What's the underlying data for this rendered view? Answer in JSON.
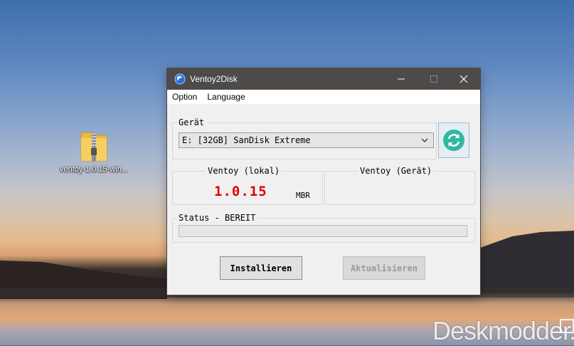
{
  "desktop": {
    "icon_label": "ventoy-1.0.15-win...",
    "watermark": "Deskmodder.de"
  },
  "window": {
    "title": "Ventoy2Disk",
    "menu": [
      "Option",
      "Language"
    ],
    "device_group_label": "Gerät",
    "device_selected": "E: [32GB] SanDisk Extreme",
    "local_group_label": "Ventoy (lokal)",
    "local_version": "1.0.15",
    "partition_style": "MBR",
    "device_version_label": "Ventoy (Gerät)",
    "device_version": "",
    "status_label": "Status - BEREIT",
    "progress": 0,
    "install_button": "Installieren",
    "update_button": "Aktualisieren"
  },
  "colors": {
    "version_text": "#e00000",
    "refresh_icon": "#2eb8a0",
    "titlebar": "#4d4a48"
  },
  "icons": {
    "app": "ventoy-logo-icon",
    "refresh": "refresh-icon",
    "zip": "zip-folder-icon"
  }
}
